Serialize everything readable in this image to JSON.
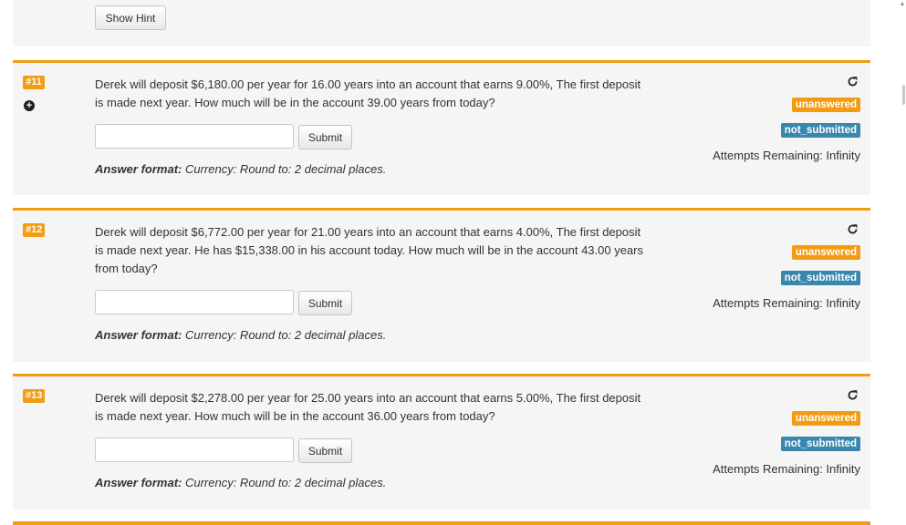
{
  "top": {
    "hint_label": "Show Hint"
  },
  "questions": [
    {
      "number": "#11",
      "text": "Derek will deposit $6,180.00 per year for 16.00 years into an account that earns 9.00%, The first deposit is made next year. How much will be in the account 39.00 years from today?",
      "input_value": "",
      "submit_label": "Submit",
      "format_label": "Answer format:",
      "format_value": " Currency: Round to: 2 decimal places.",
      "status": "unanswered",
      "submission": "not_submitted",
      "attempts": "Attempts Remaining: Infinity",
      "has_expand": true
    },
    {
      "number": "#12",
      "text": "Derek will deposit $6,772.00 per year for 21.00 years into an account that earns 4.00%, The first deposit is made next year. He has $15,338.00 in his account today. How much will be in the account 43.00 years from today?",
      "input_value": "",
      "submit_label": "Submit",
      "format_label": "Answer format:",
      "format_value": " Currency: Round to: 2 decimal places.",
      "status": "unanswered",
      "submission": "not_submitted",
      "attempts": "Attempts Remaining: Infinity",
      "has_expand": false
    },
    {
      "number": "#13",
      "text": "Derek will deposit $2,278.00 per year for 25.00 years into an account that earns 5.00%, The first deposit is made next year. How much will be in the account 36.00 years from today?",
      "input_value": "",
      "submit_label": "Submit",
      "format_label": "Answer format:",
      "format_value": " Currency: Round to: 2 decimal places.",
      "status": "unanswered",
      "submission": "not_submitted",
      "attempts": "Attempts Remaining: Infinity",
      "has_expand": false
    }
  ],
  "colors": {
    "accent": "#f39c12",
    "status_blue": "#3a87ad",
    "card_bg": "#f5f5f5"
  },
  "icons": {
    "refresh": "refresh-icon",
    "expand": "plus-circle-icon"
  }
}
